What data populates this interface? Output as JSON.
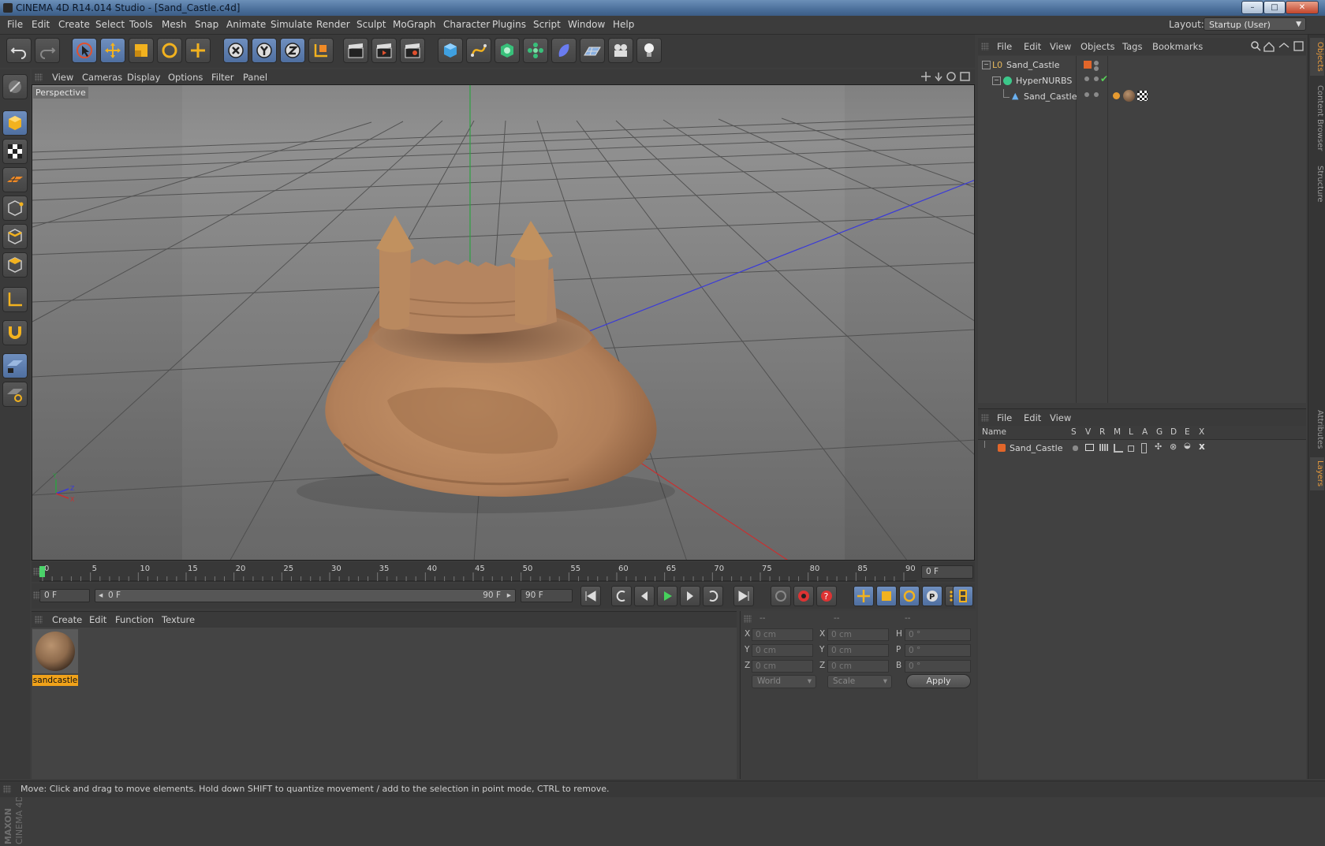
{
  "window": {
    "title": "CINEMA 4D R14.014 Studio - [Sand_Castle.c4d]",
    "minimize": "–",
    "maximize": "□",
    "close": "✕"
  },
  "menubar": {
    "items": [
      "File",
      "Edit",
      "Create",
      "Select",
      "Tools",
      "Mesh",
      "Snap",
      "Animate",
      "Simulate",
      "Render",
      "Sculpt",
      "MoGraph",
      "Character",
      "Plugins",
      "Script",
      "Window",
      "Help"
    ]
  },
  "layout": {
    "label": "Layout:",
    "value": "Startup (User)"
  },
  "viewport": {
    "menu": [
      "View",
      "Cameras",
      "Display",
      "Options",
      "Filter",
      "Panel"
    ],
    "label": "Perspective",
    "axis": {
      "y": "Y",
      "z": "Z",
      "x": "X"
    }
  },
  "timeline": {
    "ticks": [
      "0",
      "5",
      "10",
      "15",
      "20",
      "25",
      "30",
      "35",
      "40",
      "45",
      "50",
      "55",
      "60",
      "65",
      "70",
      "75",
      "80",
      "85",
      "90"
    ],
    "current_frame": "0 F"
  },
  "transport": {
    "start_field": "0 F",
    "range_start": "0 F",
    "range_end": "90 F",
    "end_field": "90 F"
  },
  "material_manager": {
    "menu": [
      "Create",
      "Edit",
      "Function",
      "Texture"
    ],
    "materials": [
      {
        "name": "sandcastle"
      }
    ]
  },
  "coordinates": {
    "headers": [
      "--",
      "--",
      "--"
    ],
    "rows": [
      {
        "l1": "X",
        "v1": "0 cm",
        "l2": "X",
        "v2": "0 cm",
        "l3": "H",
        "v3": "0 °"
      },
      {
        "l1": "Y",
        "v1": "0 cm",
        "l2": "Y",
        "v2": "0 cm",
        "l3": "P",
        "v3": "0 °"
      },
      {
        "l1": "Z",
        "v1": "0 cm",
        "l2": "Z",
        "v2": "0 cm",
        "l3": "B",
        "v3": "0 °"
      }
    ],
    "space": "World",
    "mode": "Scale",
    "apply": "Apply"
  },
  "object_manager": {
    "menu": [
      "File",
      "Edit",
      "View",
      "Objects",
      "Tags",
      "Bookmarks"
    ],
    "objects": [
      {
        "name": "Sand_Castle"
      },
      {
        "name": "HyperNURBS"
      },
      {
        "name": "Sand_Castle"
      }
    ]
  },
  "layer_manager": {
    "menu": [
      "File",
      "Edit",
      "View"
    ],
    "columns": [
      "Name",
      "S",
      "V",
      "R",
      "M",
      "L",
      "A",
      "G",
      "D",
      "E",
      "X"
    ],
    "layers": [
      {
        "name": "Sand_Castle"
      }
    ]
  },
  "right_tabs": [
    "Objects",
    "Content Browser",
    "Structure",
    "Attributes",
    "Layers"
  ],
  "status": "Move: Click and drag to move elements. Hold down SHIFT to quantize movement / add to the selection in point mode, CTRL to remove.",
  "logo": {
    "maxon": "MAXON",
    "product": "CINEMA 4D"
  },
  "colors": {
    "accent": "#e79a3c",
    "selection": "#5a7fb5",
    "sand": "#b98760"
  }
}
